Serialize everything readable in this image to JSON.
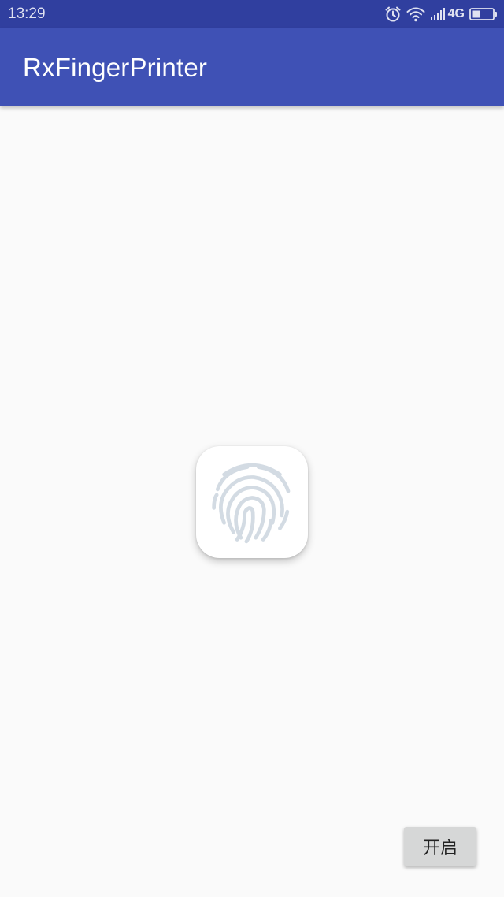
{
  "status_bar": {
    "time": "13:29",
    "network": "4G",
    "icons": [
      "alarm-icon",
      "wifi-icon",
      "signal-icon",
      "battery-icon"
    ]
  },
  "app_bar": {
    "title": "RxFingerPrinter",
    "color": "#3f51b5",
    "status_color": "#303f9f"
  },
  "main": {
    "fingerprint_icon": "fingerprint-icon"
  },
  "actions": {
    "open_label": "开启"
  }
}
